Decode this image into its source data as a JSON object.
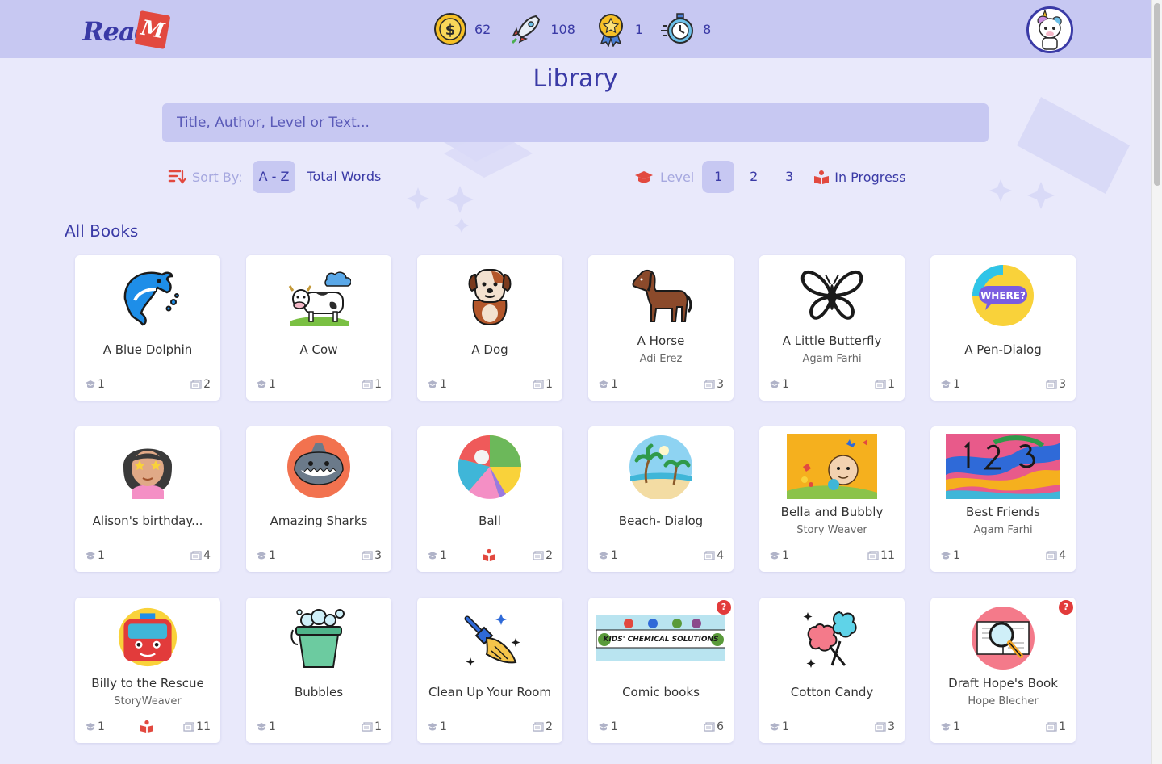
{
  "header": {
    "logo_text": "Read",
    "logo_flag": "M",
    "stats": [
      {
        "icon": "coin-icon",
        "value": "62"
      },
      {
        "icon": "rocket-icon",
        "value": "108"
      },
      {
        "icon": "medal-icon",
        "value": "1"
      },
      {
        "icon": "stopwatch-icon",
        "value": "8"
      }
    ],
    "avatar_icon": "unicorn-avatar-icon"
  },
  "page_title": "Library",
  "search": {
    "placeholder": "Title, Author, Level or Text...",
    "value": ""
  },
  "sort": {
    "label": "Sort By:",
    "options": [
      {
        "label": "A - Z",
        "active": true
      },
      {
        "label": "Total Words",
        "active": false
      }
    ]
  },
  "level": {
    "label": "Level",
    "options": [
      {
        "label": "1",
        "active": true
      },
      {
        "label": "2",
        "active": false
      },
      {
        "label": "3",
        "active": false
      }
    ],
    "in_progress_label": "In Progress"
  },
  "section_title": "All Books",
  "colors": {
    "accent": "#3a3aa6",
    "header_bg": "#c7c8f2",
    "page_bg": "#e9e9fb",
    "red": "#e2493f"
  },
  "books": [
    {
      "title": "A Blue Dolphin",
      "author": "",
      "level": "1",
      "pages": "2",
      "in_progress": false,
      "badge": false,
      "icon": "dolphin-icon"
    },
    {
      "title": "A Cow",
      "author": "",
      "level": "1",
      "pages": "1",
      "in_progress": false,
      "badge": false,
      "icon": "cow-icon"
    },
    {
      "title": "A Dog",
      "author": "",
      "level": "1",
      "pages": "1",
      "in_progress": false,
      "badge": false,
      "icon": "dog-icon"
    },
    {
      "title": "A Horse",
      "author": "Adi Erez",
      "level": "1",
      "pages": "3",
      "in_progress": false,
      "badge": false,
      "icon": "horse-icon"
    },
    {
      "title": "A Little Butterfly",
      "author": "Agam Farhi",
      "level": "1",
      "pages": "1",
      "in_progress": false,
      "badge": false,
      "icon": "butterfly-icon"
    },
    {
      "title": "A Pen-Dialog",
      "author": "",
      "level": "1",
      "pages": "3",
      "in_progress": false,
      "badge": false,
      "icon": "where-bubble-icon",
      "icon_text": "WHERE?"
    },
    {
      "title": "Alison's birthday...",
      "author": "",
      "level": "1",
      "pages": "4",
      "in_progress": false,
      "badge": false,
      "icon": "girl-icon"
    },
    {
      "title": "Amazing Sharks",
      "author": "",
      "level": "1",
      "pages": "3",
      "in_progress": false,
      "badge": false,
      "icon": "shark-icon"
    },
    {
      "title": "Ball",
      "author": "",
      "level": "1",
      "pages": "2",
      "in_progress": true,
      "badge": false,
      "icon": "ball-icon"
    },
    {
      "title": "Beach- Dialog",
      "author": "",
      "level": "1",
      "pages": "4",
      "in_progress": false,
      "badge": false,
      "icon": "beach-icon"
    },
    {
      "title": "Bella and Bubbly",
      "author": "Story Weaver",
      "level": "1",
      "pages": "11",
      "in_progress": false,
      "badge": false,
      "icon": "bella-cover-icon"
    },
    {
      "title": "Best Friends",
      "author": "Agam Farhi",
      "level": "1",
      "pages": "4",
      "in_progress": false,
      "badge": false,
      "icon": "numbers-painting-icon"
    },
    {
      "title": "Billy to the Rescue",
      "author": "StoryWeaver",
      "level": "1",
      "pages": "11",
      "in_progress": true,
      "badge": false,
      "icon": "bus-icon"
    },
    {
      "title": "Bubbles",
      "author": "",
      "level": "1",
      "pages": "1",
      "in_progress": false,
      "badge": false,
      "icon": "bucket-bubbles-icon"
    },
    {
      "title": "Clean Up Your Room",
      "author": "",
      "level": "1",
      "pages": "2",
      "in_progress": false,
      "badge": false,
      "icon": "broom-icon"
    },
    {
      "title": "Comic books",
      "author": "",
      "level": "1",
      "pages": "6",
      "in_progress": false,
      "badge": true,
      "icon": "comic-banner-icon",
      "icon_text": "KIDS' CHEMICAL SOLUTIONS"
    },
    {
      "title": "Cotton Candy",
      "author": "",
      "level": "1",
      "pages": "3",
      "in_progress": false,
      "badge": false,
      "icon": "cotton-candy-icon"
    },
    {
      "title": "Draft Hope's Book",
      "author": "Hope Blecher",
      "level": "1",
      "pages": "1",
      "in_progress": false,
      "badge": true,
      "icon": "magnifier-book-icon"
    }
  ],
  "badge_symbol": "?"
}
